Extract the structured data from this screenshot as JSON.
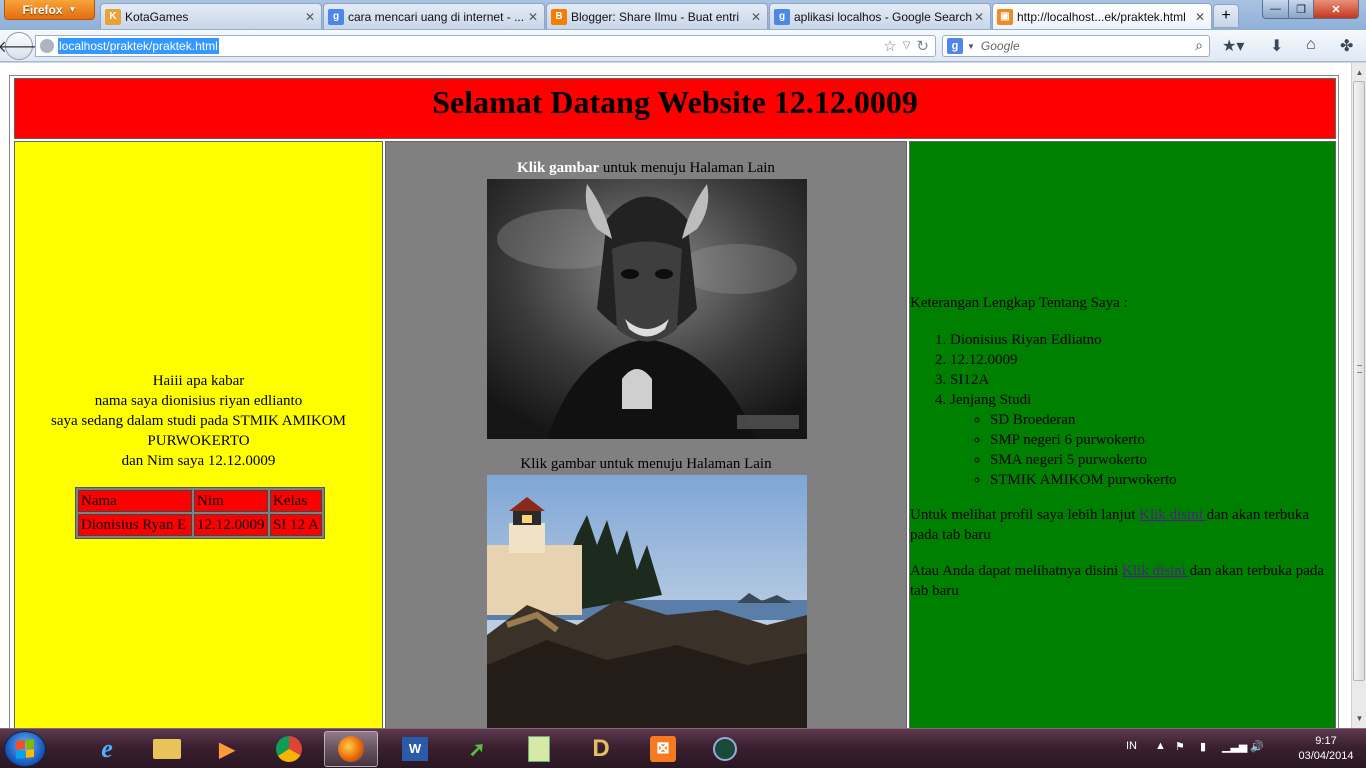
{
  "browser": {
    "firefox_button_label": "Firefox",
    "tabs": [
      {
        "label": "KotaGames",
        "favicon_color": "#e8a23a",
        "favicon_glyph": "K"
      },
      {
        "label": "cara mencari uang di internet - ...",
        "favicon_color": "#4f86e8",
        "favicon_glyph": "g"
      },
      {
        "label": "Blogger: Share Ilmu - Buat entri",
        "favicon_color": "#f57d00",
        "favicon_glyph": "B"
      },
      {
        "label": "aplikasi localhos - Google Search",
        "favicon_color": "#4f86e8",
        "favicon_glyph": "g"
      },
      {
        "label": "http://localhost...ek/praktek.html",
        "favicon_color": "#f08a24",
        "favicon_glyph": "▣"
      }
    ],
    "new_tab_glyph": "+",
    "url": "localhost/praktek/praktek.html",
    "search_engine_glyph": "g",
    "search_placeholder": "Google",
    "window_controls": {
      "minimize": "—",
      "maximize": "❐",
      "close": "✕"
    }
  },
  "page": {
    "header_title": "Selamat Datang Website 12.12.0009",
    "left": {
      "intro_lines": [
        "Haiii apa kabar",
        "nama saya dionisius riyan edlianto",
        "saya sedang dalam studi pada STMIK AMIKOM PURWOKERTO",
        "dan Nim saya 12.12.0009"
      ],
      "table": {
        "headers": [
          "Nama",
          "Nim",
          "Kelas"
        ],
        "rows": [
          [
            "Dionisius Ryan E",
            "12.12.0009",
            "SI 12 A"
          ]
        ]
      }
    },
    "middle": {
      "caption1_bold": "Klik gambar",
      "caption1_rest": " untuk menuju Halaman Lain",
      "caption2": "Klik gambar untuk menuju Halaman Lain"
    },
    "right": {
      "heading": "Keterangan Lengkap Tentang Saya :",
      "list": [
        "Dionisius Riyan Edliatno",
        "12.12.0009",
        "SI12A",
        "Jenjang Studi"
      ],
      "sublist": [
        "SD Broederan",
        "SMP negeri 6 purwokerto",
        "SMA negeri 5 purwokerto",
        "STMIK AMIKOM purwokerto"
      ],
      "p1_before": "Untuk melihat profil saya lebih lanjut ",
      "p1_link": "Klik disini ",
      "p1_after": "dan akan terbuka pada tab baru",
      "p2_before": "Atau Anda dapat melihatnya disini ",
      "p2_link": "Klik disini ",
      "p2_after": "dan akan terbuka pada tab baru"
    },
    "colors": {
      "header": "#ff0000",
      "left": "#ffff00",
      "middle": "#808080",
      "right": "#008000"
    }
  },
  "taskbar": {
    "tray_lang": "IN",
    "time": "9:17",
    "date": "03/04/2014"
  }
}
